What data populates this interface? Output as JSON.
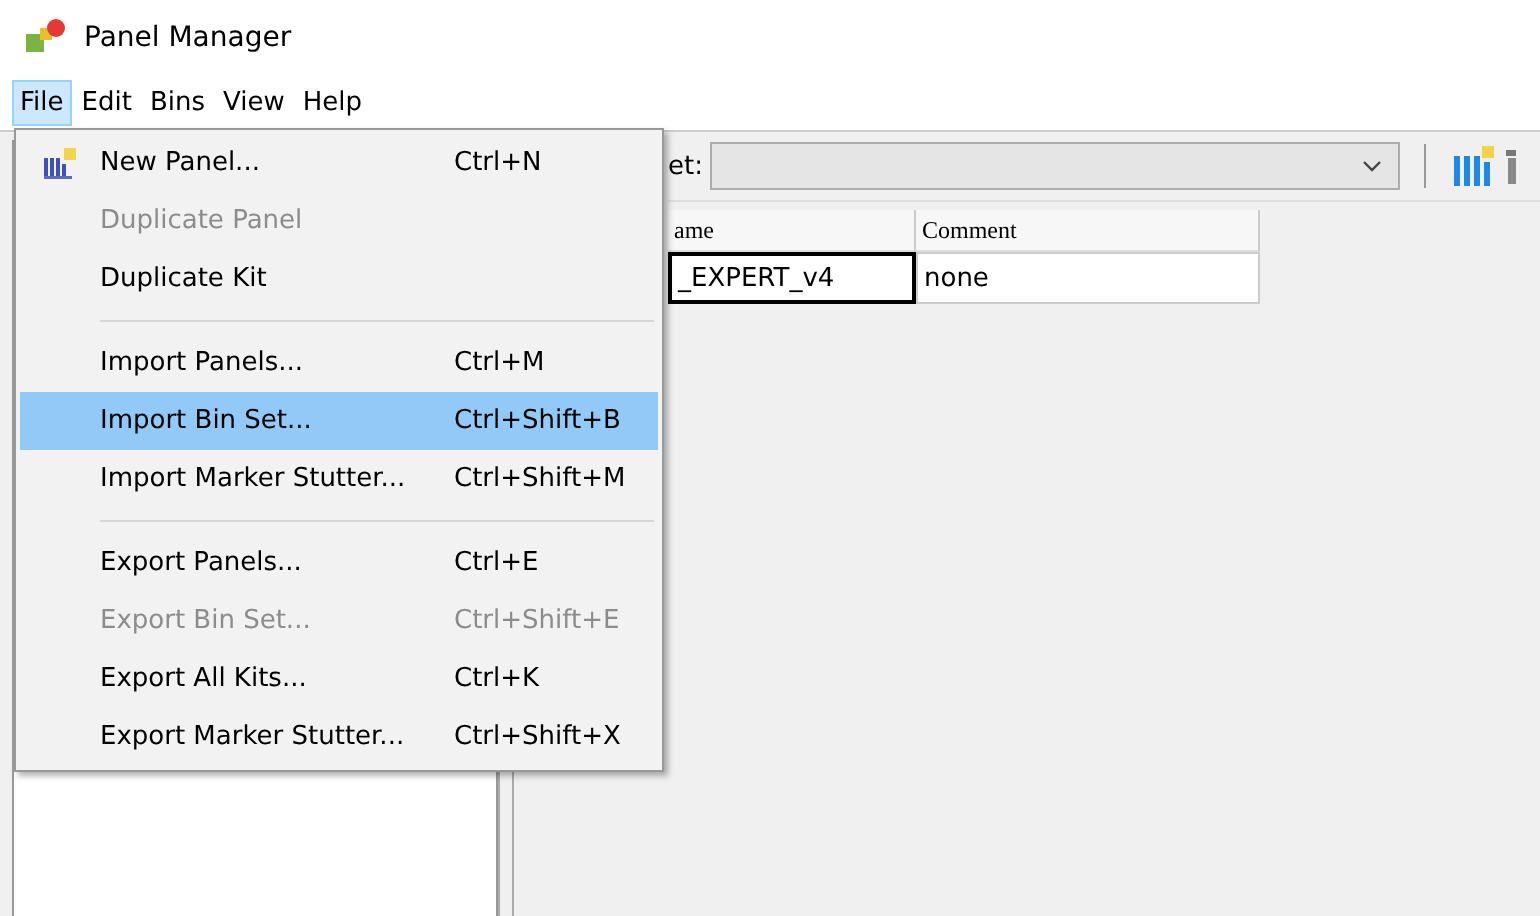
{
  "window": {
    "title": "Panel Manager"
  },
  "menu_bar": [
    {
      "label": "File",
      "selected": true
    },
    {
      "label": "Edit",
      "selected": false
    },
    {
      "label": "Bins",
      "selected": false
    },
    {
      "label": "View",
      "selected": false
    },
    {
      "label": "Help",
      "selected": false
    }
  ],
  "file_menu": [
    {
      "kind": "item",
      "label": "New Panel...",
      "shortcut": "Ctrl+N",
      "icon": true,
      "disabled": false,
      "selected": false
    },
    {
      "kind": "item",
      "label": "Duplicate Panel",
      "disabled": true,
      "selected": false
    },
    {
      "kind": "item",
      "label": "Duplicate Kit",
      "disabled": false,
      "selected": false
    },
    {
      "kind": "separator"
    },
    {
      "kind": "item",
      "label": "Import Panels...",
      "shortcut": "Ctrl+M",
      "disabled": false,
      "selected": false
    },
    {
      "kind": "item",
      "label": "Import Bin Set...",
      "shortcut": "Ctrl+Shift+B",
      "disabled": false,
      "selected": true
    },
    {
      "kind": "item",
      "label": "Import Marker Stutter...",
      "shortcut": "Ctrl+Shift+M",
      "disabled": false,
      "selected": false
    },
    {
      "kind": "separator"
    },
    {
      "kind": "item",
      "label": "Export Panels...",
      "shortcut": "Ctrl+E",
      "disabled": false,
      "selected": false
    },
    {
      "kind": "item",
      "label": "Export Bin Set...",
      "shortcut": "Ctrl+Shift+E",
      "disabled": true,
      "selected": false
    },
    {
      "kind": "item",
      "label": "Export All Kits...",
      "shortcut": "Ctrl+K",
      "disabled": false,
      "selected": false
    },
    {
      "kind": "item",
      "label": "Export Marker Stutter...",
      "shortcut": "Ctrl+Shift+X",
      "disabled": false,
      "selected": false
    }
  ],
  "toolbar": {
    "label": "et:"
  },
  "table": {
    "columns": [
      "ame",
      "Comment"
    ],
    "rows": [
      [
        "_EXPERT_v4",
        "none"
      ]
    ]
  }
}
